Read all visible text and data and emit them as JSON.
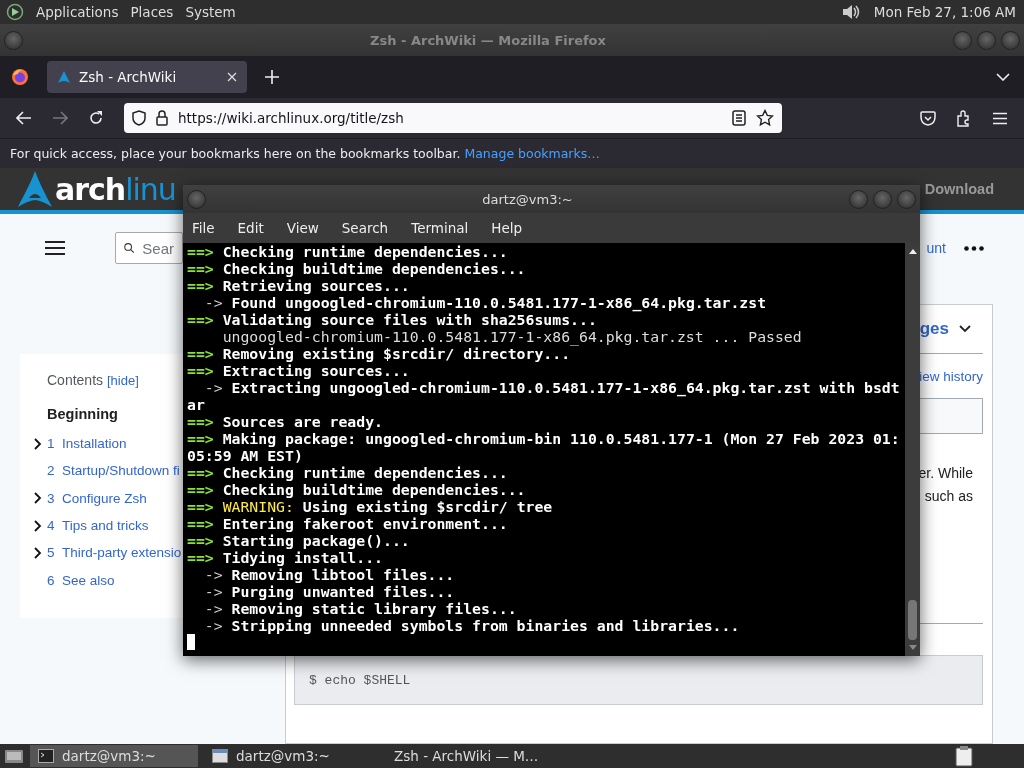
{
  "top_panel": {
    "menus": [
      "Applications",
      "Places",
      "System"
    ],
    "clock": "Mon Feb 27, 1:06 AM"
  },
  "browser": {
    "title": "Zsh - ArchWiki — Mozilla Firefox",
    "tabs": [
      {
        "label": "Zsh - ArchWiki",
        "selected": true
      }
    ],
    "forward_disabled": true,
    "url": "https://wiki.archlinux.org/title/zsh",
    "bookmarks_hint": "For quick access, place your bookmarks here on the bookmarks toolbar.",
    "bookmarks_link": "Manage bookmarks…"
  },
  "wiki": {
    "logo_primary": "arch",
    "logo_secondary": "linu",
    "header_link": "Download",
    "search_placeholder": "Sear",
    "account_link": "unt",
    "contents": {
      "title": "Contents",
      "toggle": "[hide]",
      "heading": "Beginning",
      "items": [
        {
          "number": "1",
          "label": "Installation",
          "expandable": true
        },
        {
          "number": "2",
          "label": "Startup/Shutdown fi",
          "expandable": false
        },
        {
          "number": "3",
          "label": "Configure Zsh",
          "expandable": true
        },
        {
          "number": "4",
          "label": "Tips and tricks",
          "expandable": true
        },
        {
          "number": "5",
          "label": "Third-party extensio",
          "expandable": true
        },
        {
          "number": "6",
          "label": "See also",
          "expandable": false
        }
      ]
    },
    "languages": "ges",
    "view_history": "iew history",
    "paragraph": [
      "er. While",
      "such as"
    ],
    "code": "$ echo $SHELL"
  },
  "terminal": {
    "title": "dartz@vm3:~",
    "menus": [
      "File",
      "Edit",
      "View",
      "Search",
      "Terminal",
      "Help"
    ],
    "lines": [
      {
        "kind": "step",
        "prefix": "==>",
        "text": " Checking runtime dependencies..."
      },
      {
        "kind": "step",
        "prefix": "==>",
        "text": " Checking buildtime dependencies..."
      },
      {
        "kind": "step",
        "prefix": "==>",
        "text": " Retrieving sources..."
      },
      {
        "kind": "sub",
        "prefix": "  ->",
        "text": " Found ungoogled-chromium-110.0.5481.177-1-x86_64.pkg.tar.zst"
      },
      {
        "kind": "step",
        "prefix": "==>",
        "text": " Validating source files with sha256sums..."
      },
      {
        "kind": "detail",
        "text": "    ungoogled-chromium-110.0.5481.177-1-x86_64.pkg.tar.zst ... Passed"
      },
      {
        "kind": "step",
        "prefix": "==>",
        "text": " Removing existing $srcdir/ directory..."
      },
      {
        "kind": "step",
        "prefix": "==>",
        "text": " Extracting sources..."
      },
      {
        "kind": "sub",
        "prefix": "  ->",
        "text": " Extracting ungoogled-chromium-110.0.5481.177-1-x86_64.pkg.tar.zst with bsdt"
      },
      {
        "kind": "continued",
        "text": "ar"
      },
      {
        "kind": "step",
        "prefix": "==>",
        "text": " Sources are ready."
      },
      {
        "kind": "step",
        "prefix": "==>",
        "text": " Making package: ungoogled-chromium-bin 110.0.5481.177-1 (Mon 27 Feb 2023 01:"
      },
      {
        "kind": "continued",
        "text": "05:59 AM EST)"
      },
      {
        "kind": "step",
        "prefix": "==>",
        "text": " Checking runtime dependencies..."
      },
      {
        "kind": "step",
        "prefix": "==>",
        "text": " Checking buildtime dependencies..."
      },
      {
        "kind": "warning",
        "prefix": "==>",
        "label": " WARNING:",
        "text": " Using existing $srcdir/ tree"
      },
      {
        "kind": "step",
        "prefix": "==>",
        "text": " Entering fakeroot environment..."
      },
      {
        "kind": "step",
        "prefix": "==>",
        "text": " Starting package()..."
      },
      {
        "kind": "step",
        "prefix": "==>",
        "text": " Tidying install..."
      },
      {
        "kind": "sub",
        "prefix": "  ->",
        "text": " Removing libtool files..."
      },
      {
        "kind": "sub",
        "prefix": "  ->",
        "text": " Purging unwanted files..."
      },
      {
        "kind": "sub",
        "prefix": "  ->",
        "text": " Removing static library files..."
      },
      {
        "kind": "sub",
        "prefix": "  ->",
        "text": " Stripping unneeded symbols from binaries and libraries..."
      }
    ]
  },
  "taskbar": {
    "tasks": [
      {
        "kind": "terminal",
        "label": "dartz@vm3:~",
        "selected": true
      },
      {
        "kind": "window",
        "label": "dartz@vm3:~",
        "selected": false
      },
      {
        "kind": "browser",
        "label": "Zsh - ArchWiki — M…",
        "selected": false
      }
    ]
  }
}
